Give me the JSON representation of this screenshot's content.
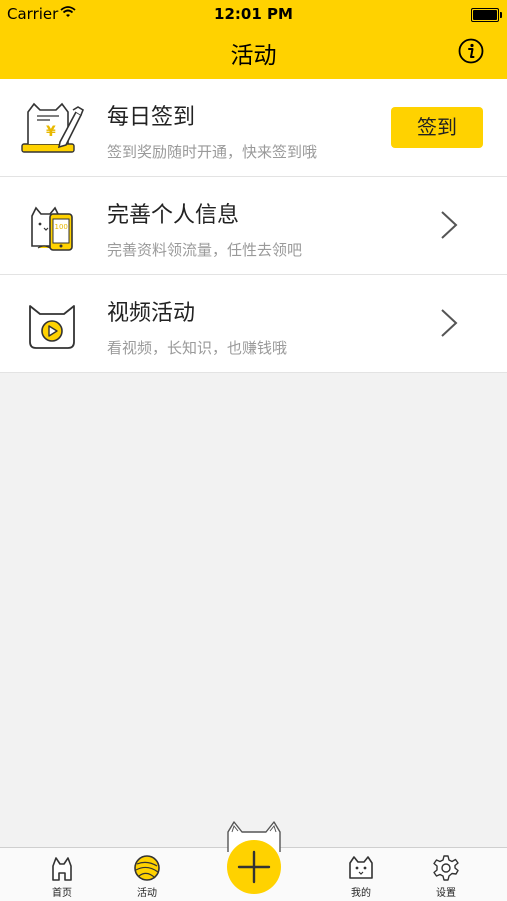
{
  "status_bar": {
    "carrier": "Carrier",
    "time": "12:01 PM"
  },
  "nav": {
    "title": "活动",
    "info_icon": "info-icon"
  },
  "list": [
    {
      "icon": "cat-sign-in-icon",
      "title": "每日签到",
      "subtitle": "签到奖励随时开通，快来签到哦",
      "action_label": "签到"
    },
    {
      "icon": "cat-phone-icon",
      "title": "完善个人信息",
      "subtitle": "完善资料领流量，任性去领吧",
      "phone_text": "100"
    },
    {
      "icon": "cat-video-icon",
      "title": "视频活动",
      "subtitle": "看视频，长知识，也赚钱哦"
    }
  ],
  "tabbar": {
    "items": [
      {
        "label": "首页",
        "icon": "home-icon"
      },
      {
        "label": "活动",
        "icon": "yarn-ball-icon",
        "active": true
      },
      {
        "label": "我的",
        "icon": "cat-face-icon"
      },
      {
        "label": "设置",
        "icon": "gear-icon"
      }
    ],
    "center_icon": "plus-icon"
  },
  "colors": {
    "accent": "#ffd200",
    "background": "#f2f2f2",
    "subtitle": "#9a9a9a"
  }
}
